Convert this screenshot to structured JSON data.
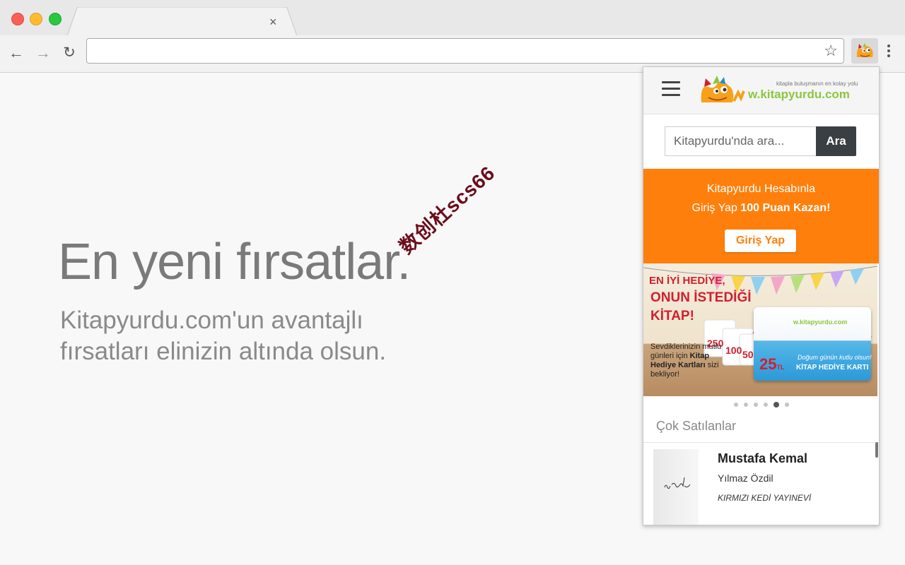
{
  "browser": {
    "tab_close_glyph": "×",
    "omnibox_value": "",
    "star_glyph": "☆",
    "nav": {
      "back_glyph": "←",
      "forward_glyph": "→",
      "reload_glyph": "↻"
    }
  },
  "page": {
    "title": "En yeni fırsatlar.",
    "subtitle": "Kitapyurdu.com'un avantajlı fırsatları elinizin altında olsun.",
    "watermark": "数创杜scs66"
  },
  "popup": {
    "logo": {
      "tagline": "kitapla buluşmanın en kolay yolu",
      "text": "w.kitapyurdu.com"
    },
    "search": {
      "placeholder": "Kitapyurdu'nda ara...",
      "button_label": "Ara"
    },
    "promo": {
      "line1": "Kitapyurdu Hesabınla",
      "line2_prefix": "Giriş Yap ",
      "line2_bold": "100 Puan Kazan!",
      "button_label": "Giriş Yap"
    },
    "banner": {
      "heading1": "EN İYİ HEDİYE,",
      "heading2": "ONUN İSTEDİĞİ",
      "heading3": "KİTAP!",
      "body_prefix": "Sevdiklerinizin mutlu günleri için ",
      "body_bold": "Kitap Hediye Kartları",
      "body_suffix": " sizi bekliyor!",
      "card_logo": "w.kitapyurdu.com",
      "card_amount": "25",
      "card_currency": "TL",
      "card_script": "Doğum günün kutlu olsun!",
      "card_label": "KİTAP HEDİYE KARTI"
    },
    "carousel": {
      "count": 6,
      "active_index": 4
    },
    "bestsellers": {
      "title": "Çok Satılanlar",
      "items": [
        {
          "title": "Mustafa Kemal",
          "author": "Yılmaz Özdil",
          "publisher": "KIRMIZI KEDİ YAYINEVİ"
        }
      ]
    }
  },
  "colors": {
    "accent_orange": "#ff7f0c",
    "search_button": "#3a3f44",
    "logo_green": "#8cc63f",
    "promo_red": "#d0202e"
  }
}
